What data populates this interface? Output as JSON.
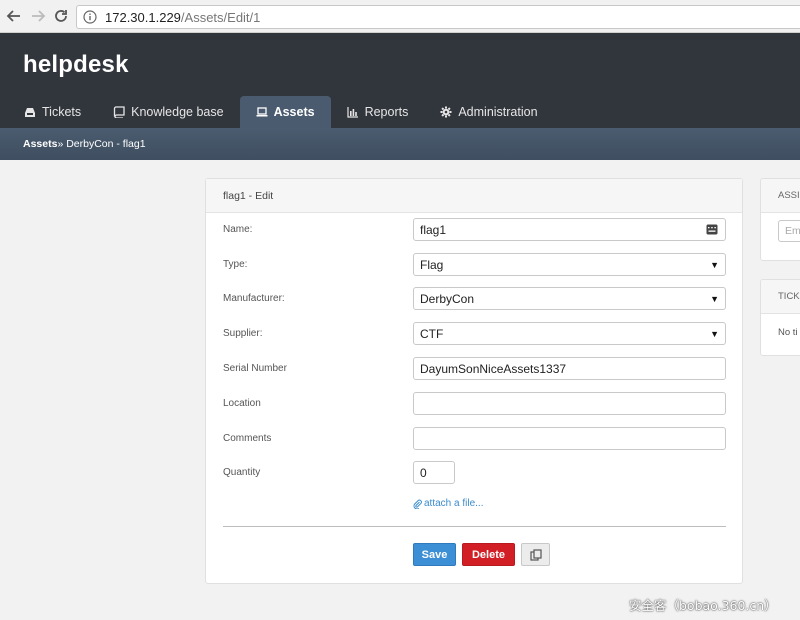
{
  "browser": {
    "url_host": "172.30.1.229",
    "url_path": "/Assets/Edit/1"
  },
  "app": {
    "brand": "helpdesk",
    "tabs": [
      {
        "label": "Tickets",
        "icon": "inbox-icon",
        "active": false
      },
      {
        "label": "Knowledge base",
        "icon": "book-icon",
        "active": false
      },
      {
        "label": "Assets",
        "icon": "laptop-icon",
        "active": true
      },
      {
        "label": "Reports",
        "icon": "bar-chart-icon",
        "active": false
      },
      {
        "label": "Administration",
        "icon": "gear-icon",
        "active": false
      }
    ]
  },
  "breadcrumb": {
    "root": "Assets",
    "rest": " » DerbyCon - flag1"
  },
  "form": {
    "title": "flag1 - Edit",
    "fields": [
      {
        "label": "Name:",
        "value": "flag1",
        "kind": "text"
      },
      {
        "label": "Type:",
        "value": "Flag",
        "kind": "select"
      },
      {
        "label": "Manufacturer:",
        "value": "DerbyCon",
        "kind": "select"
      },
      {
        "label": "Supplier:",
        "value": "CTF",
        "kind": "select"
      },
      {
        "label": "Serial Number",
        "value": "DayumSonNiceAssets1337",
        "kind": "text"
      },
      {
        "label": "Location",
        "value": "",
        "kind": "text"
      },
      {
        "label": "Comments",
        "value": "",
        "kind": "text"
      },
      {
        "label": "Quantity",
        "value": "0",
        "kind": "number"
      }
    ],
    "attach_label": "attach a file...",
    "save_label": "Save",
    "delete_label": "Delete"
  },
  "side": {
    "assign_head": "ASSIGN",
    "assign_placeholder": "Em",
    "tickets_head": "TICKETS",
    "tickets_text": "No ti"
  },
  "watermark": "安全客（bobao.360.cn）",
  "colors": {
    "header_bg": "#31353c",
    "active_tab": "#4a5b70",
    "save": "#3c8fd4",
    "delete": "#d21f26",
    "link": "#3a8bcc"
  }
}
